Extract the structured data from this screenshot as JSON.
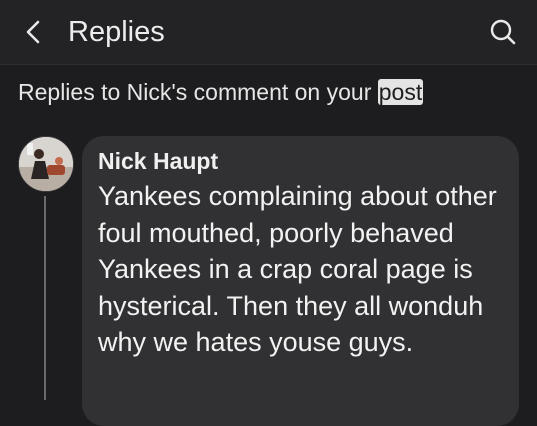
{
  "header": {
    "title": "Replies",
    "back_icon": "chevron-left-icon",
    "search_icon": "search-icon"
  },
  "subtitle": {
    "prefix": "Replies to Nick's comment on your ",
    "post_link": "post"
  },
  "comment": {
    "author": "Nick Haupt",
    "text": "Yankees complaining about other foul mouthed, poorly behaved Yankees in a crap coral page is hysterical. Then they all wonduh why we hates youse guys.",
    "avatar": "user-avatar"
  },
  "colors": {
    "background": "#1d1d1f",
    "bubble": "#313133",
    "text": "#f2f2f2"
  }
}
